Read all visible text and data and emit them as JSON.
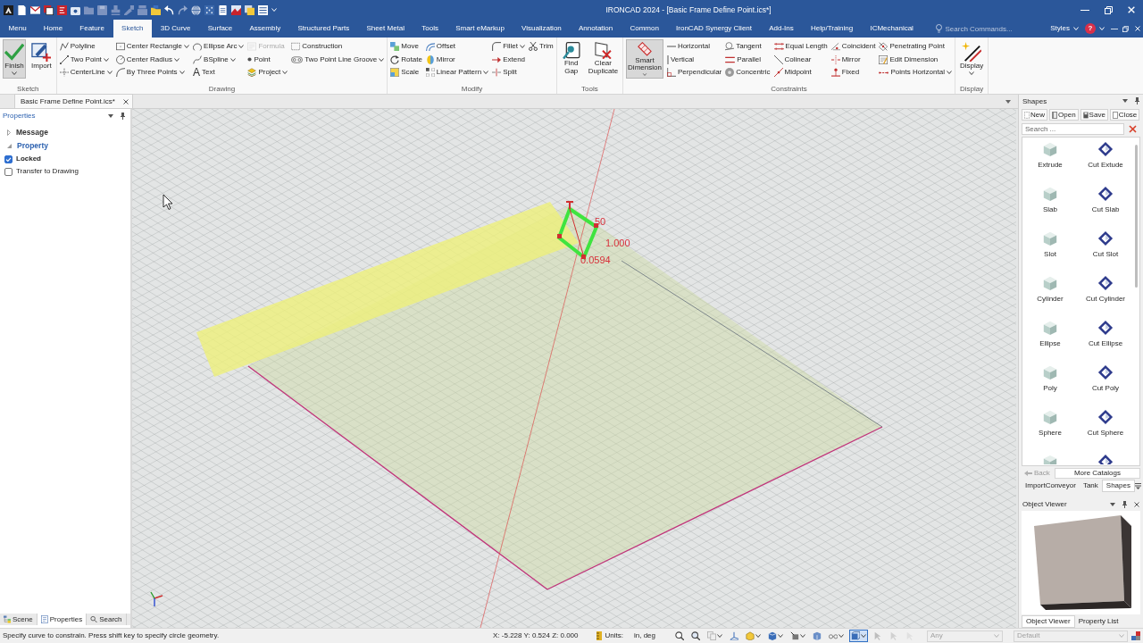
{
  "window": {
    "title": "IRONCAD 2024 - [Basic Frame Define Point.ics*]"
  },
  "ribbon_tabs": [
    {
      "label": "Menu",
      "selected": false
    },
    {
      "label": "Home",
      "selected": false
    },
    {
      "label": "Feature",
      "selected": false
    },
    {
      "label": "Sketch",
      "selected": true
    },
    {
      "label": "3D Curve",
      "selected": false
    },
    {
      "label": "Surface",
      "selected": false
    },
    {
      "label": "Assembly",
      "selected": false
    },
    {
      "label": "Structured Parts",
      "selected": false
    },
    {
      "label": "Sheet Metal",
      "selected": false
    },
    {
      "label": "Tools",
      "selected": false
    },
    {
      "label": "Smart eMarkup",
      "selected": false
    },
    {
      "label": "Visualization",
      "selected": false
    },
    {
      "label": "Annotation",
      "selected": false
    },
    {
      "label": "Common",
      "selected": false
    },
    {
      "label": "IronCAD Synergy Client",
      "selected": false
    },
    {
      "label": "Add-Ins",
      "selected": false
    },
    {
      "label": "Help/Training",
      "selected": false
    },
    {
      "label": "ICMechanical",
      "selected": false
    }
  ],
  "command_search": {
    "placeholder": "Search Commands..."
  },
  "styles_menu": {
    "label": "Styles"
  },
  "help_button": {
    "label": "?"
  },
  "ribbon_groups": [
    {
      "title": "Sketch",
      "columns": [
        {
          "kind": "large",
          "label": "Finish",
          "pressed": true,
          "dropdown": true
        },
        {
          "kind": "large",
          "label": "Import",
          "pressed": false,
          "dropdown": false
        }
      ]
    },
    {
      "title": "Drawing",
      "columns": [
        {
          "kind": "stack",
          "items": [
            {
              "label": "Polyline",
              "dropdown": false,
              "disabled": false
            },
            {
              "label": "Two Point",
              "dropdown": true,
              "disabled": false
            },
            {
              "label": "CenterLine",
              "dropdown": true,
              "disabled": false
            }
          ]
        },
        {
          "kind": "stack",
          "items": [
            {
              "label": "Center Rectangle",
              "dropdown": true,
              "disabled": false
            },
            {
              "label": "Center Radius",
              "dropdown": true,
              "disabled": false
            },
            {
              "label": "By Three Points",
              "dropdown": true,
              "disabled": false
            }
          ]
        },
        {
          "kind": "stack",
          "items": [
            {
              "label": "Ellipse Arc",
              "dropdown": true,
              "disabled": false
            },
            {
              "label": "BSpline",
              "dropdown": true,
              "disabled": false
            },
            {
              "label": "Text",
              "glyph": "A",
              "dropdown": false,
              "disabled": false
            }
          ]
        },
        {
          "kind": "stack",
          "items": [
            {
              "label": "Formula",
              "dropdown": false,
              "disabled": true
            },
            {
              "label": "Point",
              "dropdown": false,
              "disabled": false
            },
            {
              "label": "Project",
              "dropdown": true,
              "disabled": false
            }
          ]
        },
        {
          "kind": "stack",
          "items": [
            {
              "label": "Construction",
              "dropdown": false,
              "disabled": false
            },
            {
              "label": "Two Point Line Groove",
              "dropdown": true,
              "disabled": false
            }
          ]
        }
      ]
    },
    {
      "title": "Modify",
      "columns": [
        {
          "kind": "stack",
          "items": [
            {
              "label": "Move",
              "dropdown": false,
              "disabled": false
            },
            {
              "label": "Rotate",
              "dropdown": false,
              "disabled": false
            },
            {
              "label": "Scale",
              "dropdown": false,
              "disabled": false
            }
          ]
        },
        {
          "kind": "stack",
          "items": [
            {
              "label": "Offset",
              "dropdown": false,
              "disabled": false
            },
            {
              "label": "Mirror",
              "dropdown": false,
              "disabled": false
            },
            {
              "label": "Linear Pattern",
              "dropdown": true,
              "disabled": false
            }
          ]
        },
        {
          "kind": "stack",
          "items": [
            {
              "label": "Fillet",
              "dropdown": true,
              "disabled": false
            },
            {
              "label": "Extend",
              "dropdown": false,
              "disabled": false
            },
            {
              "label": "Split",
              "dropdown": false,
              "disabled": false
            }
          ]
        },
        {
          "kind": "stack",
          "items": [
            {
              "label": "Trim",
              "dropdown": false,
              "disabled": false
            }
          ]
        }
      ]
    },
    {
      "title": "Tools",
      "columns": [
        {
          "kind": "large",
          "label": "Find Gap",
          "pressed": false,
          "dropdown": false
        },
        {
          "kind": "large",
          "label": "Clear Duplicate",
          "pressed": false,
          "dropdown": false
        }
      ]
    },
    {
      "title": "Constraints",
      "columns": [
        {
          "kind": "large",
          "label": "Smart Dimension",
          "pressed": true,
          "dropdown": true
        },
        {
          "kind": "stack",
          "items": [
            {
              "label": "Horizontal",
              "dropdown": false,
              "disabled": false
            },
            {
              "label": "Vertical",
              "dropdown": false,
              "disabled": false
            },
            {
              "label": "Perpendicular",
              "dropdown": false,
              "disabled": false
            }
          ]
        },
        {
          "kind": "stack",
          "items": [
            {
              "label": "Tangent",
              "dropdown": false,
              "disabled": false
            },
            {
              "label": "Parallel",
              "dropdown": false,
              "disabled": false
            },
            {
              "label": "Concentric",
              "dropdown": false,
              "disabled": false
            }
          ]
        },
        {
          "kind": "stack",
          "items": [
            {
              "label": "Equal Length",
              "dropdown": false,
              "disabled": false
            },
            {
              "label": "Colinear",
              "dropdown": false,
              "disabled": false
            },
            {
              "label": "Midpoint",
              "dropdown": false,
              "disabled": false
            }
          ]
        },
        {
          "kind": "stack",
          "items": [
            {
              "label": "Coincident",
              "dropdown": false,
              "disabled": false
            },
            {
              "label": "Mirror",
              "dropdown": false,
              "disabled": false
            },
            {
              "label": "Fixed",
              "dropdown": false,
              "disabled": false
            }
          ]
        },
        {
          "kind": "stack",
          "items": [
            {
              "label": "Penetrating Point",
              "dropdown": false,
              "disabled": false
            },
            {
              "label": "Edit Dimension",
              "dropdown": false,
              "disabled": false
            },
            {
              "label": "Points Horizontal",
              "dropdown": true,
              "disabled": false
            }
          ]
        }
      ]
    },
    {
      "title": "Display",
      "columns": [
        {
          "kind": "large",
          "label": "Display",
          "pressed": false,
          "dropdown": true
        }
      ]
    }
  ],
  "document_tab": {
    "label": "Basic Frame Define Point.ics*"
  },
  "properties_panel": {
    "title": "Properties",
    "sections": [
      {
        "label": "Message",
        "expanded": false,
        "selected": false
      },
      {
        "label": "Property",
        "expanded": true,
        "selected": true,
        "options": [
          {
            "label": "Locked",
            "checked": true
          },
          {
            "label": "Transfer to Drawing",
            "checked": false
          }
        ]
      }
    ],
    "tabs": [
      {
        "label": "Scene",
        "selected": false
      },
      {
        "label": "Properties",
        "selected": true
      },
      {
        "label": "Search",
        "selected": false
      }
    ]
  },
  "viewport": {
    "dimension_labels": [
      "50",
      "1.000",
      "0.0594"
    ]
  },
  "shapes_panel": {
    "title": "Shapes",
    "buttons": [
      "New",
      "Open",
      "Save",
      "Close"
    ],
    "search": {
      "placeholder": "Search ..."
    },
    "items": [
      {
        "label": "Extrude",
        "kind": "solid"
      },
      {
        "label": "Cut Extude",
        "kind": "cut"
      },
      {
        "label": "Slab",
        "kind": "solid"
      },
      {
        "label": "Cut Slab",
        "kind": "cut"
      },
      {
        "label": "Slot",
        "kind": "solid"
      },
      {
        "label": "Cut Slot",
        "kind": "cut"
      },
      {
        "label": "Cylinder",
        "kind": "solid"
      },
      {
        "label": "Cut Cylinder",
        "kind": "cut"
      },
      {
        "label": "Ellipse",
        "kind": "solid"
      },
      {
        "label": "Cut Ellipse",
        "kind": "cut"
      },
      {
        "label": "Poly",
        "kind": "solid"
      },
      {
        "label": "Cut Poly",
        "kind": "cut"
      },
      {
        "label": "Sphere",
        "kind": "solid"
      },
      {
        "label": "Cut Sphere",
        "kind": "cut"
      }
    ],
    "back_button": {
      "label": "Back",
      "disabled": true
    },
    "more_button": {
      "label": "More Catalogs"
    },
    "tabs": [
      {
        "label": "ImportConveyor",
        "selected": false
      },
      {
        "label": "Tank",
        "selected": false
      },
      {
        "label": "Shapes",
        "selected": true
      }
    ]
  },
  "object_viewer": {
    "title": "Object Viewer",
    "tabs": [
      {
        "label": "Object Viewer",
        "selected": true
      },
      {
        "label": "Property List",
        "selected": false
      }
    ]
  },
  "status_bar": {
    "message": "Specify curve to constrain. Press shift key to specify circle geometry.",
    "coordinates": "X: -5.228 Y: 0.524 Z: 0.000",
    "units_label": "Units:",
    "units": "in, deg",
    "view_button": {
      "pressed": true
    },
    "filters": [
      {
        "value": "Any",
        "disabled": true
      },
      {
        "value": "Default",
        "disabled": true
      }
    ]
  }
}
